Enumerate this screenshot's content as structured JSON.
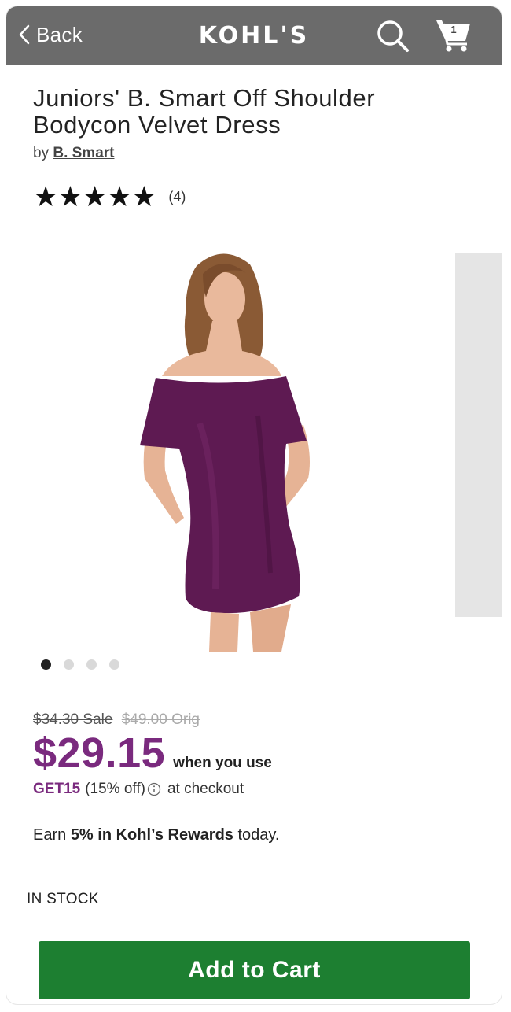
{
  "header": {
    "back_label": "Back",
    "logo_text": "KOHL'S",
    "cart_count": "1",
    "bar_color": "#6b6b6b"
  },
  "product": {
    "title": "Juniors' B. Smart Off Shoulder Bodycon Velvet Dress",
    "by_label": "by",
    "brand": "B. Smart",
    "stars": "★★★★★",
    "rating": 5,
    "review_count": "(4)",
    "dress_color": "#5e1a52"
  },
  "gallery": {
    "count": 4,
    "active_index": 0
  },
  "pricing": {
    "sale_price": "$34.30 Sale",
    "orig_price": "$49.00 Orig",
    "price": "$29.15",
    "when_label": "when you use",
    "coupon_code": "GET15",
    "coupon_detail": "(15% off)",
    "checkout_label": "at checkout",
    "accent_color": "#7a2a7e"
  },
  "rewards": {
    "prefix": "Earn",
    "bold": "5% in Kohl’s Rewards",
    "suffix": "today."
  },
  "stock_status": "IN STOCK",
  "add_to_cart_label": "Add to Cart",
  "add_to_cart_color": "#1d7f31"
}
